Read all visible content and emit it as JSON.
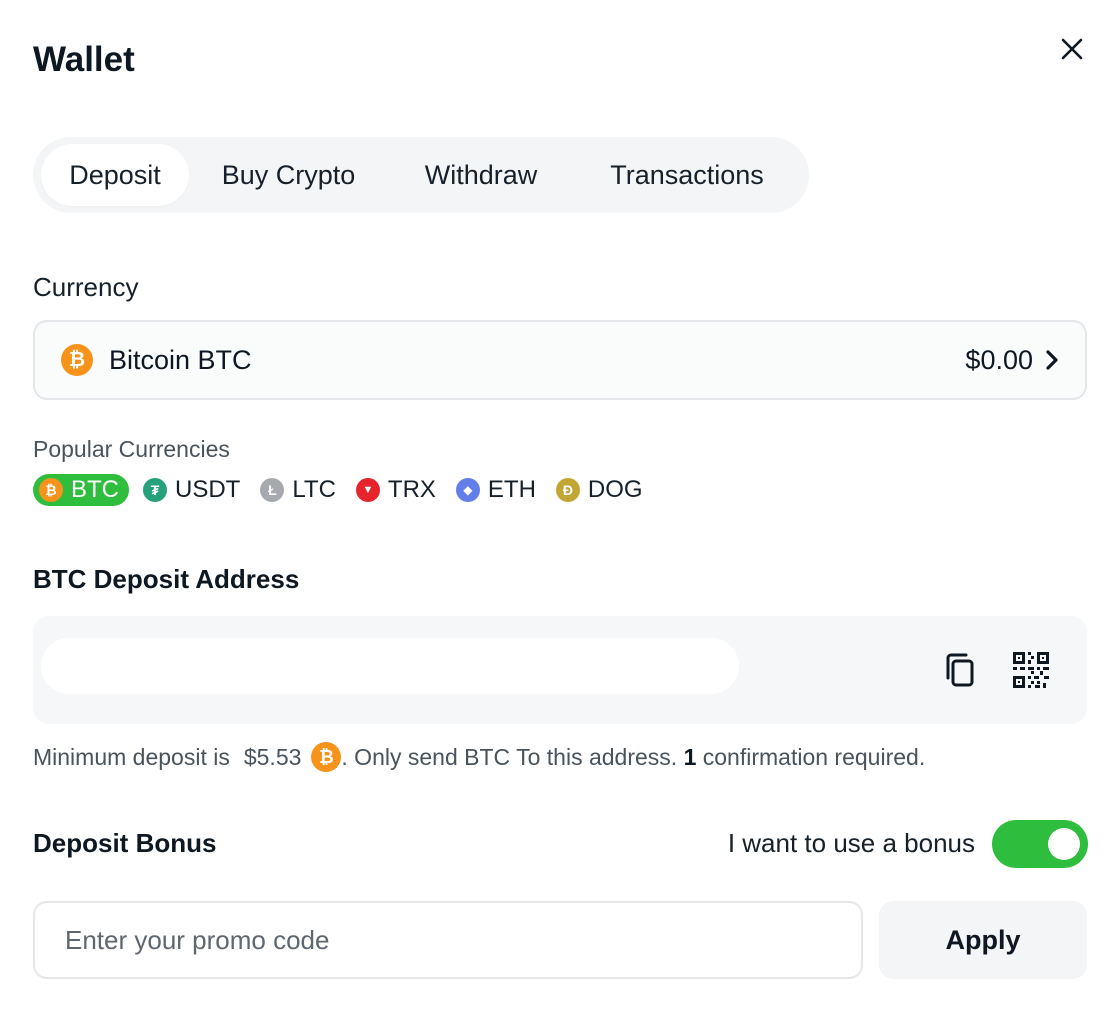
{
  "window": {
    "title": "Wallet",
    "close_icon": "close-icon"
  },
  "tabs": [
    {
      "label": "Deposit",
      "active": true
    },
    {
      "label": "Buy Crypto",
      "active": false
    },
    {
      "label": "Withdraw",
      "active": false
    },
    {
      "label": "Transactions",
      "active": false
    }
  ],
  "currency": {
    "label": "Currency",
    "selected_name": "Bitcoin BTC",
    "balance": "$0.00",
    "icon": "bitcoin-icon"
  },
  "popular": {
    "label": "Popular Currencies",
    "items": [
      {
        "label": "BTC",
        "icon": "bitcoin-icon",
        "glyph": "₿",
        "color": "#f7931a",
        "active": true
      },
      {
        "label": "USDT",
        "icon": "tether-icon",
        "glyph": "₮",
        "color": "#26a17b",
        "active": false
      },
      {
        "label": "LTC",
        "icon": "litecoin-icon",
        "glyph": "Ł",
        "color": "#a6a9ad",
        "active": false
      },
      {
        "label": "TRX",
        "icon": "tron-icon",
        "glyph": "▼",
        "color": "#e5242c",
        "active": false
      },
      {
        "label": "ETH",
        "icon": "ethereum-icon",
        "glyph": "◆",
        "color": "#627eea",
        "active": false
      },
      {
        "label": "DOG",
        "icon": "dogecoin-icon",
        "glyph": "Ð",
        "color": "#c2a633",
        "active": false
      }
    ]
  },
  "deposit_address": {
    "label": "BTC Deposit Address",
    "value": "",
    "copy_icon": "copy-icon",
    "qr_icon": "qr-code-icon"
  },
  "minimum": {
    "prefix": "Minimum deposit is",
    "amount": "$5.53",
    "middle": ". Only send BTC To this address.",
    "confirmations": "1",
    "suffix": "confirmation required."
  },
  "bonus": {
    "label": "Deposit Bonus",
    "toggle_label": "I want to use a bonus",
    "toggle_on": true
  },
  "promo": {
    "placeholder": "Enter your promo code",
    "value": "",
    "apply_label": "Apply"
  },
  "colors": {
    "accent_green": "#2ebd3d",
    "bitcoin_orange": "#f7931a",
    "text_dark": "#0e1822",
    "text_muted": "#49535c"
  }
}
